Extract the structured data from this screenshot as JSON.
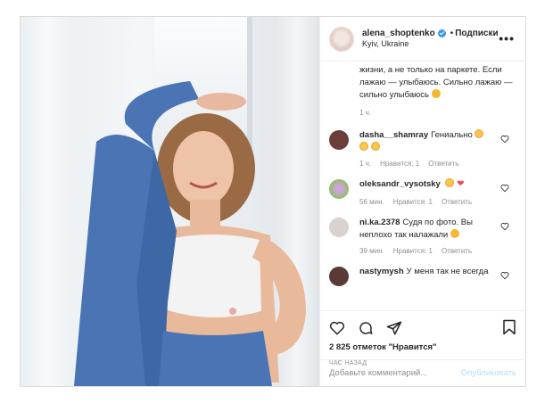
{
  "post": {
    "username": "alena_shoptenko",
    "dot": "•",
    "follow_label": "Подписки",
    "location": "Kyiv, Ukraine",
    "more": "•••"
  },
  "caption": {
    "text": "жизни, а не только на паркете. Если лажаю — улыбаюсь. Сильно лажаю — сильно улыбаюсь",
    "time": "1 ч."
  },
  "comments": [
    {
      "user": "dasha__shamray",
      "text": "Гениально",
      "time": "1 ч.",
      "likes": "Нравится: 1",
      "reply": "Ответить",
      "avatar_color": "#6b3e3a"
    },
    {
      "user": "oleksandr_vysotsky",
      "text": "",
      "time": "56 мин.",
      "likes": "Нравится: 1",
      "reply": "Ответить",
      "avatar_color": "#8fbf5a"
    },
    {
      "user": "ni.ka.2378",
      "text": "Судя по фото. Вы неплохо так налажали",
      "time": "39 мин.",
      "likes": "Нравится: 1",
      "reply": "Ответить",
      "avatar_color": "#d9d2cf"
    },
    {
      "user": "nastymysh",
      "text": "У меня так не всегда",
      "time": "",
      "likes": "",
      "reply": "",
      "avatar_color": "#5a3a34"
    }
  ],
  "actions": {
    "likes_count": "2 825 отметок \"Нравится\"",
    "time_ago": "ЧАС НАЗАД"
  },
  "add_comment": {
    "placeholder": "Добавьте комментарий...",
    "post_label": "Опубликовать"
  },
  "colors": {
    "accent": "#3897f0",
    "post_disabled": "#b2dffc",
    "muted": "#8e8e8e",
    "blazer": "#4a74b4"
  }
}
